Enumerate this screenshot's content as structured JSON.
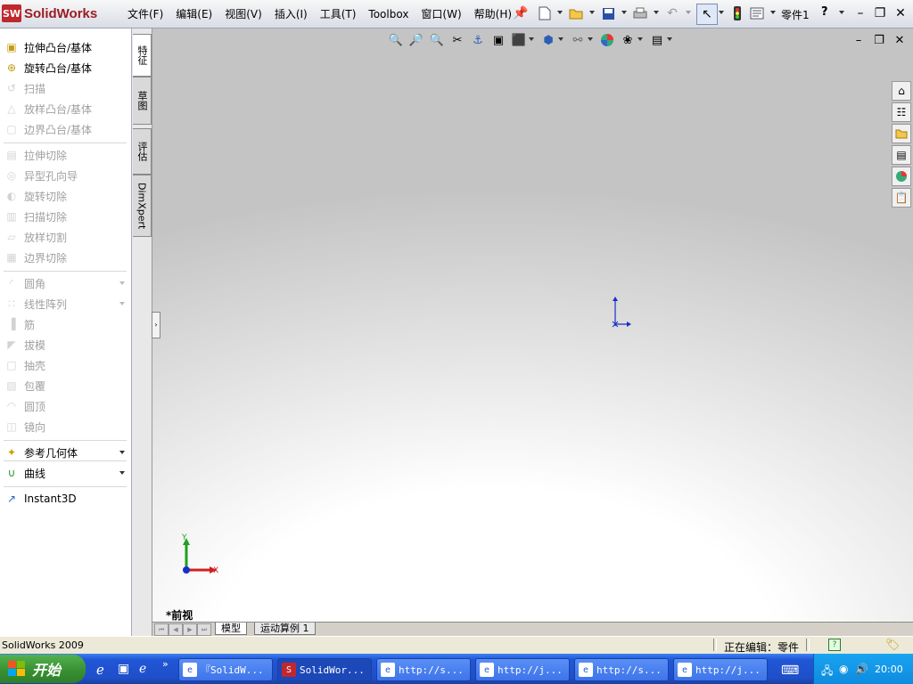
{
  "app": {
    "logo_text": "SolidWorks",
    "logo_badge": "SW"
  },
  "menu": [
    "文件(F)",
    "编辑(E)",
    "视图(V)",
    "插入(I)",
    "工具(T)",
    "Toolbox",
    "窗口(W)",
    "帮助(H)"
  ],
  "document_title": "零件1",
  "help_label": "?",
  "features": [
    {
      "label": "拉伸凸台/基体",
      "enabled": true,
      "icon": "extrude-boss-icon"
    },
    {
      "label": "旋转凸台/基体",
      "enabled": true,
      "icon": "revolve-boss-icon"
    },
    {
      "label": "扫描",
      "enabled": false,
      "icon": "sweep-icon"
    },
    {
      "label": "放样凸台/基体",
      "enabled": false,
      "icon": "loft-icon"
    },
    {
      "label": "边界凸台/基体",
      "enabled": false,
      "icon": "boundary-boss-icon"
    },
    {
      "label": "拉伸切除",
      "enabled": false,
      "icon": "extrude-cut-icon"
    },
    {
      "label": "异型孔向导",
      "enabled": false,
      "icon": "hole-wizard-icon"
    },
    {
      "label": "旋转切除",
      "enabled": false,
      "icon": "revolve-cut-icon"
    },
    {
      "label": "扫描切除",
      "enabled": false,
      "icon": "sweep-cut-icon"
    },
    {
      "label": "放样切割",
      "enabled": false,
      "icon": "loft-cut-icon"
    },
    {
      "label": "边界切除",
      "enabled": false,
      "icon": "boundary-cut-icon"
    },
    {
      "label": "圆角",
      "enabled": false,
      "icon": "fillet-icon"
    },
    {
      "label": "线性阵列",
      "enabled": false,
      "icon": "linear-pattern-icon"
    },
    {
      "label": "筋",
      "enabled": false,
      "icon": "rib-icon"
    },
    {
      "label": "拔模",
      "enabled": false,
      "icon": "draft-icon"
    },
    {
      "label": "抽壳",
      "enabled": false,
      "icon": "shell-icon"
    },
    {
      "label": "包覆",
      "enabled": false,
      "icon": "wrap-icon"
    },
    {
      "label": "圆顶",
      "enabled": false,
      "icon": "dome-icon"
    },
    {
      "label": "镜向",
      "enabled": false,
      "icon": "mirror-icon"
    },
    {
      "label": "参考几何体",
      "enabled": true,
      "icon": "reference-geometry-icon"
    },
    {
      "label": "曲线",
      "enabled": true,
      "icon": "curves-icon"
    },
    {
      "label": "Instant3D",
      "enabled": true,
      "icon": "instant3d-icon"
    }
  ],
  "vertical_tabs": [
    "特征",
    "草图",
    "评估",
    "DimXpert"
  ],
  "view_name": "*前视",
  "bottom_tabs": [
    "模型",
    "运动算例 1"
  ],
  "triad": {
    "x": "X",
    "y": "Y"
  },
  "status": {
    "left": "SolidWorks 2009",
    "right": "正在编辑：零件"
  },
  "taskbar": {
    "start": "开始",
    "tasks": [
      "『SolidW...",
      "SolidWor...",
      "http://s...",
      "http://j...",
      "http://s...",
      "http://j..."
    ],
    "clock": "20:00"
  },
  "colors": {
    "accent": "#c0282d",
    "taskbar": "#2156d6",
    "start": "#3a9435"
  }
}
